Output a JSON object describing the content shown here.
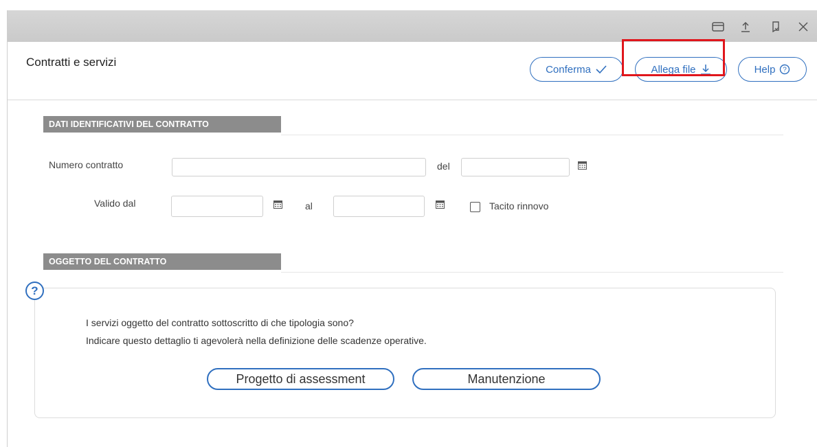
{
  "window": {
    "controls": [
      "restore-icon",
      "upload-icon",
      "bookmark-icon",
      "close-icon"
    ]
  },
  "header": {
    "title": "Contratti e servizi",
    "buttons": {
      "confirm": {
        "label": "Conferma",
        "icon": "check-icon"
      },
      "attach": {
        "label": "Allega file",
        "icon": "download-icon"
      },
      "help": {
        "label": "Help",
        "icon": "help-circle-icon"
      }
    },
    "highlight_color": "#e0161c"
  },
  "section1": {
    "title": "DATI IDENTIFICATIVI DEL CONTRATTO",
    "contract_number_label": "Numero contratto",
    "contract_number_value": "",
    "del_label": "del",
    "del_value": "",
    "valid_from_label": "Valido dal",
    "valid_from_value": "",
    "to_label": "al",
    "to_value": "",
    "tacit_renewal_label": "Tacito rinnovo",
    "tacit_renewal_checked": false
  },
  "section2": {
    "title": "OGGETTO DEL CONTRATTO",
    "question_line1": "I servizi oggetto del contratto sottoscritto di che tipologia sono?",
    "question_line2": "Indicare questo dettaglio ti agevolerà nella definizione delle scadenze operative.",
    "option1": "Progetto di assessment",
    "option2": "Manutenzione"
  },
  "colors": {
    "accent": "#2f6fbf",
    "section_bar": "#8c8c8c"
  }
}
